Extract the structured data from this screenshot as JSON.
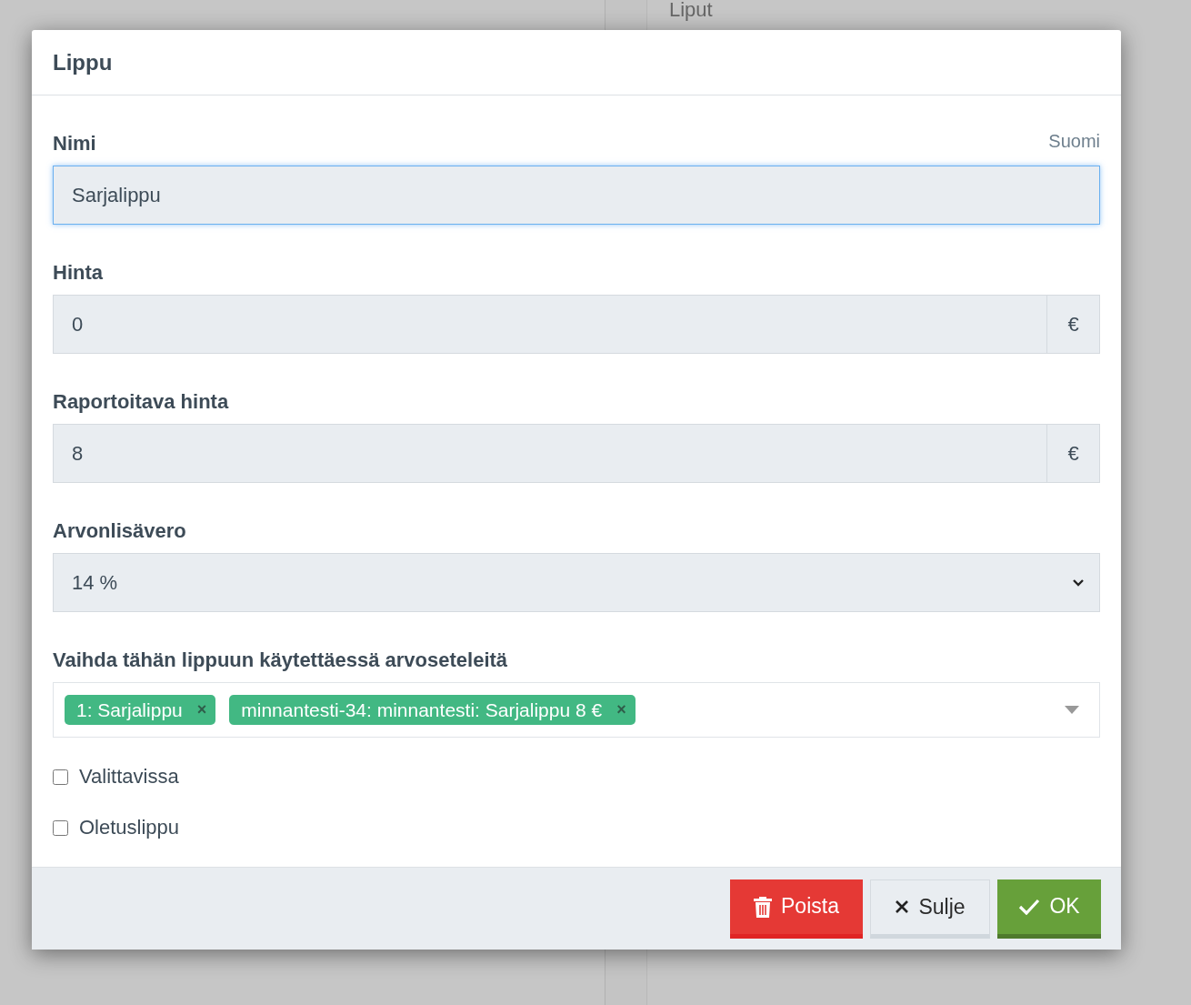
{
  "background": {
    "heading": "Liput"
  },
  "dialog": {
    "title": "Lippu",
    "fields": [
      {
        "kind": "text",
        "label": "Nimi",
        "language": "Suomi",
        "value": "Sarjalippu",
        "focused": true
      },
      {
        "kind": "addon",
        "label": "Hinta",
        "value": "0",
        "addon": "€"
      },
      {
        "kind": "addon",
        "label": "Raportoitava hinta",
        "value": "8",
        "addon": "€"
      },
      {
        "kind": "select",
        "label": "Arvonlisävero",
        "value": "14 %"
      },
      {
        "kind": "tags",
        "label": "Vaihda tähän lippuun käytettäessä arvoseteleitä",
        "tags": [
          {
            "label": "1: Sarjalippu",
            "remove": "×"
          },
          {
            "label": "minnantesti-34: minnantesti: Sarjalippu 8 €",
            "remove": "×"
          }
        ]
      }
    ],
    "checkboxes": [
      {
        "label": "Valittavissa",
        "checked": false
      },
      {
        "label": "Oletuslippu",
        "checked": false
      }
    ],
    "buttons": [
      {
        "kind": "danger",
        "label": "Poista"
      },
      {
        "kind": "default",
        "label": "Sulje"
      },
      {
        "kind": "primary",
        "label": "OK"
      }
    ]
  }
}
